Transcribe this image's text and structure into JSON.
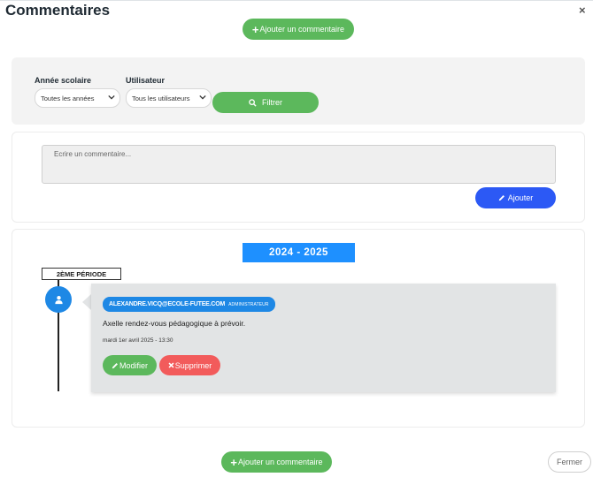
{
  "modal": {
    "title": "Commentaires",
    "close_icon": "×"
  },
  "top_add_button": {
    "plus": "+",
    "label": "Ajouter un commentaire"
  },
  "filters": {
    "year_label": "Année scolaire",
    "year_value": "Toutes les années",
    "user_label": "Utilisateur",
    "user_value": "Tous les utilisateurs",
    "filter_button": "Filtrer",
    "search_icon": "search-icon"
  },
  "composer": {
    "placeholder": "Ecrire un commentaire...",
    "submit_label": "Ajouter",
    "pencil_icon": "pencil-icon"
  },
  "timeline": {
    "year": "2024 - 2025",
    "period": "2ÈME PÉRIODE",
    "avatar_icon": "user-icon",
    "comment": {
      "author_email": "ALEXANDRE.VICQ@ECOLE-FUTEE.COM",
      "author_role": "ADMINISTRATEUR",
      "text": "Axelle rendez-vous pédagogique à prévoir.",
      "date": "mardi 1er avril 2025 - 13:30",
      "edit_label": "Modifier",
      "delete_label": "Supprimer"
    }
  },
  "bottom_add_button": {
    "plus": "+",
    "label": "Ajouter un commentaire"
  },
  "footer": {
    "close_label": "Fermer"
  },
  "colors": {
    "green": "#5cb85c",
    "blue": "#2c59f5",
    "accent_blue": "#1e88e5",
    "red": "#f25b5b"
  }
}
